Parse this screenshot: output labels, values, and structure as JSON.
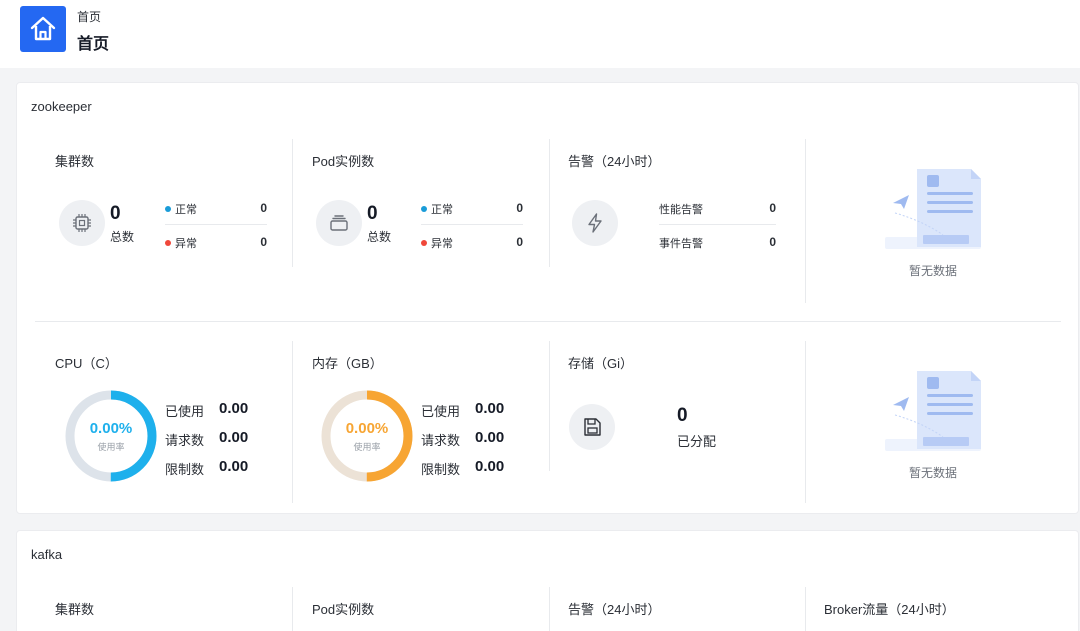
{
  "header": {
    "breadcrumb": "首页",
    "title": "首页",
    "icon": "home-icon",
    "accent": "#2468f2"
  },
  "zookeeper": {
    "title": "zookeeper",
    "cluster": {
      "title": "集群数",
      "total": "0",
      "total_label": "总数",
      "normal_label": "正常",
      "normal": "0",
      "abnormal_label": "异常",
      "abnormal": "0",
      "icon": "chip-icon"
    },
    "pod": {
      "title": "Pod实例数",
      "total": "0",
      "total_label": "总数",
      "normal_label": "正常",
      "normal": "0",
      "abnormal_label": "异常",
      "abnormal": "0",
      "icon": "stack-icon"
    },
    "alert": {
      "title": "告警（24小时）",
      "perf_label": "性能告警",
      "perf": "0",
      "event_label": "事件告警",
      "event": "0",
      "icon": "lightning-icon"
    },
    "empty1": "暂无数据",
    "cpu": {
      "title": "CPU（C）",
      "pct": "0.00%",
      "sub": "使用率",
      "used_label": "已使用",
      "used": "0.00",
      "req_label": "请求数",
      "req": "0.00",
      "limit_label": "限制数",
      "limit": "0.00",
      "color": "#1eb0ec",
      "usage": 0.5
    },
    "mem": {
      "title": "内存（GB）",
      "pct": "0.00%",
      "sub": "使用率",
      "used_label": "已使用",
      "used": "0.00",
      "req_label": "请求数",
      "req": "0.00",
      "limit_label": "限制数",
      "limit": "0.00",
      "color": "#f7a533",
      "usage": 0.5
    },
    "storage": {
      "title": "存储（Gi）",
      "value": "0",
      "label": "已分配",
      "icon": "save-icon"
    },
    "empty2": "暂无数据"
  },
  "kafka": {
    "title": "kafka",
    "cluster_title": "集群数",
    "pod_title": "Pod实例数",
    "alert_title": "告警（24小时）",
    "broker_title": "Broker流量（24小时）"
  },
  "colors": {
    "normal": "#1a9cd8",
    "abnormal": "#f0473a"
  }
}
